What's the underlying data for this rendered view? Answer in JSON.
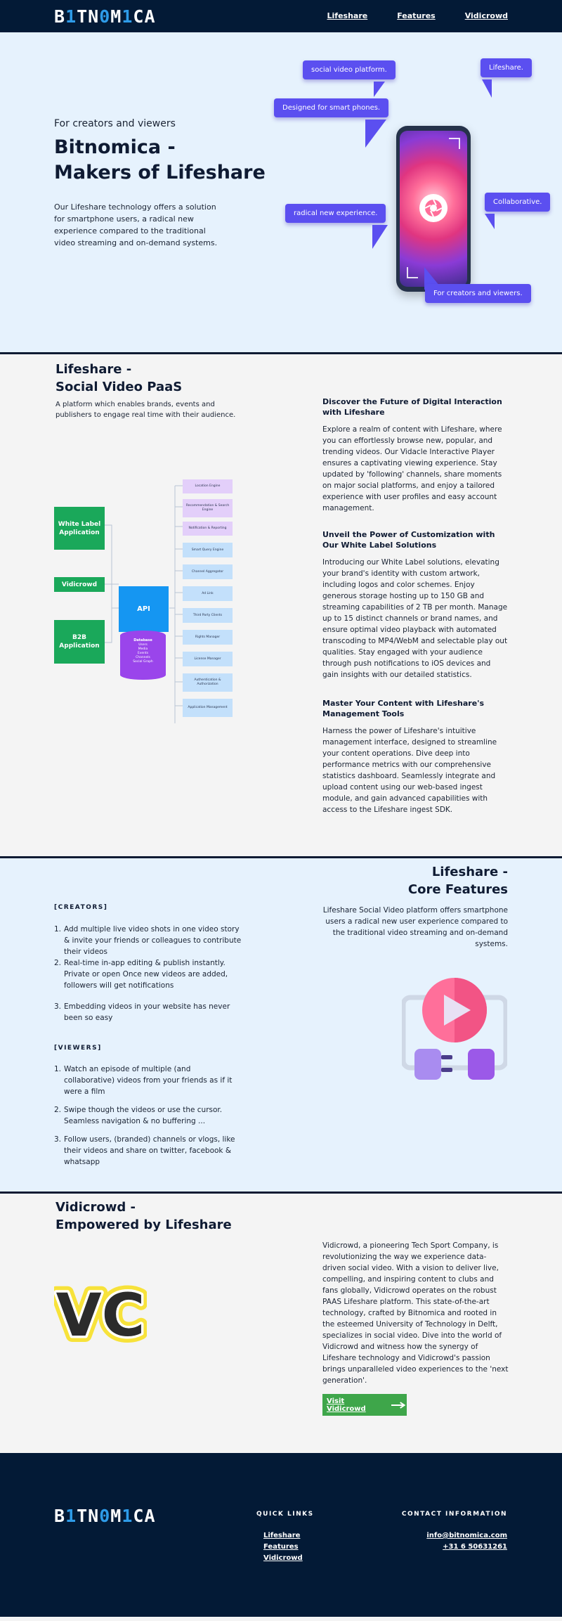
{
  "brand": {
    "logo_parts": [
      "B",
      "1",
      "TN",
      "0",
      "M",
      "1",
      "CA"
    ],
    "accent": "#2e9be8",
    "nav_bg": "#031a36"
  },
  "nav": {
    "links": [
      {
        "label": "Lifeshare"
      },
      {
        "label": "Features"
      },
      {
        "label": "Vidicrowd"
      }
    ]
  },
  "hero": {
    "kicker": "For creators and viewers",
    "title_line1": "Bitnomica -",
    "title_line2": "Makers of Lifeshare",
    "text": "Our Lifeshare technology offers a solution for smartphone users, a radical new experience compared to the traditional video streaming and on-demand systems.",
    "bubbles": {
      "social": "social video platform.",
      "lifeshare": "Lifeshare.",
      "smart": "Designed for smart phones.",
      "collab": "Collaborative.",
      "radical": "radical new experience.",
      "creators": "For creators and viewers."
    },
    "bubble_color": "#5b4ff0"
  },
  "paas": {
    "title_line1": "Lifeshare -",
    "title_line2": "Social Video PaaS",
    "subtitle": "A platform which enables brands, events and publishers to engage real time with their audience.",
    "features": [
      {
        "title": "Discover the Future of Digital Interaction with Lifeshare",
        "text": "Explore a realm of content with Lifeshare, where you can effortlessly browse new, popular, and trending videos. Our Vidacle Interactive Player ensures a captivating viewing experience. Stay updated by 'following' channels, share moments on major social platforms, and enjoy a tailored experience with user profiles and easy account management."
      },
      {
        "title": "Unveil the Power of Customization with Our White Label Solutions",
        "text": "Introducing our White Label solutions, elevating your brand's identity with custom artwork, including logos and color schemes. Enjoy generous storage hosting up to 150 GB and streaming capabilities of 2 TB per month. Manage up to 15 distinct channels or brand names, and ensure optimal video playback with automated transcoding to MP4/WebM and selectable play out qualities. Stay engaged with your audience through push notifications to iOS devices and gain insights with our detailed statistics."
      },
      {
        "title": "Master Your Content with Lifeshare's Management Tools",
        "text": "Harness the power of Lifeshare's intuitive management interface, designed to streamline your content operations. Dive deep into performance metrics with our comprehensive statistics dashboard. Seamlessly integrate and upload content using our web-based ingest module, and gain advanced capabilities with access to the Lifeshare ingest SDK."
      }
    ],
    "diagram": {
      "clients": [
        "White Label Application",
        "Vidicrowd",
        "B2B Application"
      ],
      "api": "API",
      "database_title": "Database",
      "database_items": [
        "Users",
        "Media",
        "Events",
        "Channels",
        "Social Graph"
      ],
      "services": [
        "Location Engine",
        "Recommendation & Search Engine",
        "Notification & Reporting",
        "Smart Query Engine",
        "Channel Aggregator",
        "Ad Link",
        "Third Party Clients",
        "Rights Manager",
        "License Manager",
        "Authentication & Authorization",
        "Application Management"
      ]
    }
  },
  "core": {
    "title_line1": "Lifeshare -",
    "title_line2": "Core Features",
    "text": "Lifeshare Social Video platform offers smartphone users a radical new user experience compared to the traditional video streaming and on-demand systems.",
    "creators_label": "[CREATORS]",
    "creators": [
      "Add multiple live video shots in one video story & invite your friends or colleagues to contribute their videos",
      "Real-time in-app editing & publish instantly. Private or open Once new videos are added, followers will get notifications",
      "Embedding videos in your website has never been so easy"
    ],
    "viewers_label": "[VIEWERS]",
    "viewers": [
      "Watch an episode of multiple (and collaborative) videos from your friends as if it were a film",
      "Swipe though the videos or use the cursor. Seamless navigation & no buffering ...",
      "Follow users, (branded) channels or vlogs, like their videos and share on twitter, facebook & whatsapp"
    ]
  },
  "vidicrowd": {
    "title_line1": "Vidicrowd -",
    "title_line2": "Empowered by Lifeshare",
    "text": "Vidicrowd, a pioneering Tech Sport Company, is revolutionizing the way we experience data-driven social video. With a vision to deliver live, compelling, and inspiring content to clubs and fans globally, Vidicrowd operates on the robust PAAS Lifeshare platform. This state-of-the-art technology, crafted by Bitnomica and rooted in the esteemed University of Technology in Delft, specializes in social video. Dive into the world of Vidicrowd and witness how the synergy of Lifeshare technology and Vidicrowd's passion brings unparalleled video experiences to the 'next generation'.",
    "logo_text": "VC",
    "button_label": "Visit Vidicrowd"
  },
  "footer": {
    "quick_links_label": "QUICK LINKS",
    "quick_links": [
      "Lifeshare",
      "Features",
      "Vidicrowd"
    ],
    "contact_label": "CONTACT INFORMATION",
    "email": "info@bitnomica.com",
    "phone": "+31 6 50631261"
  }
}
